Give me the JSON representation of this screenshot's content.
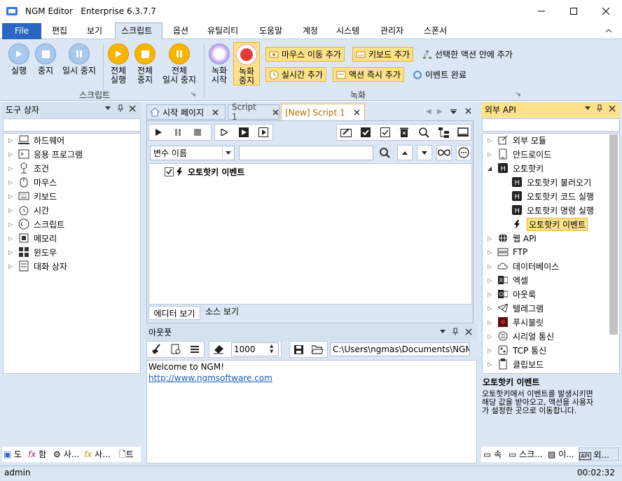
{
  "window": {
    "title": "NGM Editor   Enterprise 6.3.7.7"
  },
  "menu": {
    "file": "File",
    "items": [
      "편집",
      "보기",
      "스크립트",
      "옵션",
      "유틸리티",
      "도움말",
      "계정",
      "시스템",
      "관리자",
      "스폰서"
    ]
  },
  "ribbon": {
    "script_group": "스크립트",
    "record_group": "녹화",
    "buttons": {
      "run": "실행",
      "stop": "중지",
      "pause": "일시 중지",
      "run_all_1": "전체",
      "run_all_2": "실행",
      "stop_all_1": "전체",
      "stop_all_2": "중지",
      "pause_all_1": "전체",
      "pause_all_2": "일시 중지",
      "rec_start_1": "녹화",
      "rec_start_2": "시작",
      "rec_stop_1": "녹화",
      "rec_stop_2": "중지",
      "add_mouse": "마우스 이동 추가",
      "add_keyboard": "키보드 추가",
      "in_selected": "선택한 액션 안에 추가",
      "add_realtime": "실시간 추가",
      "add_action_now": "액션 즉시 추가",
      "event_done": "이벤트 완료"
    }
  },
  "toolbox": {
    "title": "도구 상자",
    "items": [
      "하드웨어",
      "응용 프로그램",
      "조건",
      "마우스",
      "키보드",
      "시간",
      "스크립트",
      "메모리",
      "윈도우",
      "대화 상자"
    ],
    "tabs": [
      "도",
      "함",
      "사...",
      "사...",
      "트"
    ]
  },
  "editor": {
    "tabs": [
      "시작 페이지",
      "Script 1",
      "[New] Script 1"
    ],
    "variable_select": "변수 이름",
    "event_row": "오토핫키 이벤트",
    "bottom_tabs": [
      "에디터 보기",
      "소스 보기"
    ]
  },
  "output": {
    "title": "아웃풋",
    "count": "1000",
    "path": "C:\\Users\\ngmas\\Documents\\NGM6\\",
    "lines": [
      "Welcome to NGM!"
    ],
    "link": "http://www.ngmsoftware.com"
  },
  "external_api": {
    "title": "외부 API",
    "items": [
      "외부 모듈",
      "안드로이드",
      "오토핫키",
      "웹 API",
      "FTP",
      "데이터베이스",
      "엑셀",
      "아웃룩",
      "텔레그램",
      "푸시불릿",
      "시리얼 통신",
      "TCP 통신",
      "클립보드"
    ],
    "children": [
      "오토핫키 불러오기",
      "오토핫키 코드 실행",
      "오토핫키 명령 실행",
      "오토핫키 이벤트"
    ],
    "desc_title": "오토핫키 이벤트",
    "desc_lines": [
      "오토핫키에서 이벤트를 발생시키면",
      "해당 값을 받아오고, 액션을 사용자",
      "가 설정한 곳으로 이동합니다."
    ],
    "tabs": [
      "속",
      "스크...",
      "이...",
      "외..."
    ]
  },
  "status": {
    "user": "admin",
    "time": "00:02:32"
  },
  "colors": {
    "accent": "#2b66c4",
    "ribbon": "#dce6f4",
    "highlight": "#fde28a"
  }
}
